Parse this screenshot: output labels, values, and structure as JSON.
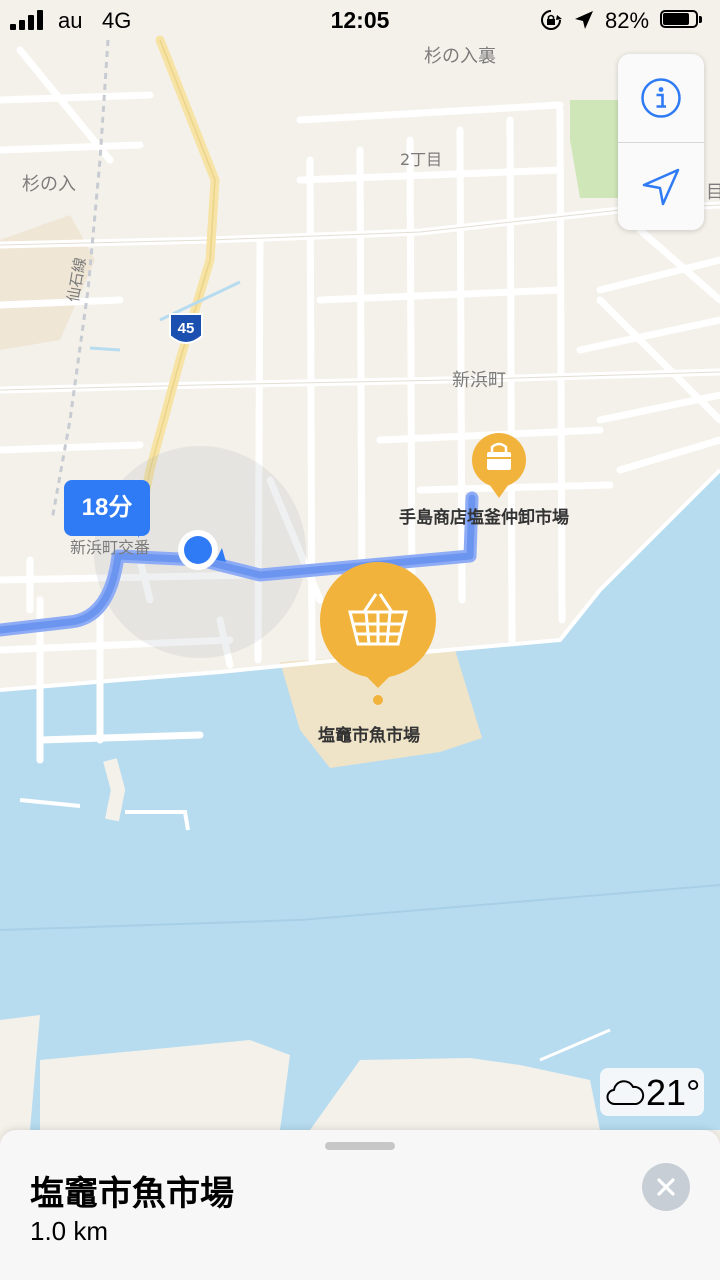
{
  "status_bar": {
    "carrier": "au",
    "network": "4G",
    "time": "12:05",
    "battery_percent": "82%",
    "battery_level": 0.82,
    "signal_bars": 4,
    "icons": [
      "rotation-lock-icon",
      "location-arrow-icon"
    ]
  },
  "map_controls": {
    "info_icon": "info-icon",
    "tracking_icon": "location-arrow-icon"
  },
  "route": {
    "eta": "18分",
    "color": "#6c95f0"
  },
  "map_labels": {
    "sugi_no_iri_ura": "杉の入裏",
    "chome_2": "2丁目",
    "sugi_no_iri": "杉の入",
    "senseki_line": "仙石線",
    "route_45": "45",
    "shinhamacho": "新浜町",
    "shinhamacho_koban": "新浜町交番",
    "edge_fragment": "目"
  },
  "pois": {
    "teshima": "手島商店塩釜仲卸市場",
    "fish_market": "塩竈市魚市場",
    "poi_color": "#f2b33d"
  },
  "weather": {
    "icon": "cloud-icon",
    "temperature": "21°"
  },
  "place_card": {
    "title": "塩竈市魚市場",
    "distance": "1.0 km",
    "close_icon": "close-icon"
  },
  "colors": {
    "water": "#b7dcf0",
    "land": "#f4f1ea",
    "park": "#cfe6b8",
    "accent": "#2f7bf5"
  }
}
